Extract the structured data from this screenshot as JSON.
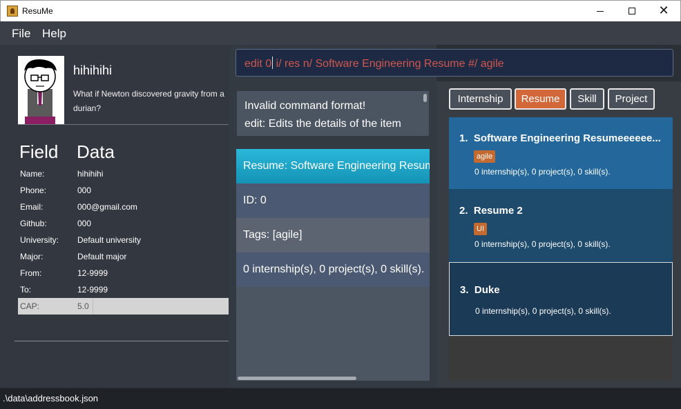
{
  "window": {
    "title": "ResuMe",
    "minimize_icon": "minimize-icon",
    "maximize_icon": "maximize-icon",
    "close_icon": "close-icon"
  },
  "menu": {
    "file": "File",
    "help": "Help"
  },
  "profile": {
    "avatar_icon": "cartoon-avatar",
    "name": "hihihihi",
    "bio": "What if Newton discovered gravity from a durian?"
  },
  "personal_table": {
    "field_header": "Field",
    "data_header": "Data",
    "rows": [
      {
        "label": "Name:",
        "value": "hihihihi"
      },
      {
        "label": "Phone:",
        "value": "000"
      },
      {
        "label": "Email:",
        "value": "000@gmail.com"
      },
      {
        "label": "Github:",
        "value": "000"
      },
      {
        "label": "University:",
        "value": "Default university"
      },
      {
        "label": "Major:",
        "value": "Default major"
      },
      {
        "label": "From:",
        "value": "12-9999"
      },
      {
        "label": "To:",
        "value": "12-9999"
      },
      {
        "label": "CAP:",
        "value": "5.0"
      }
    ]
  },
  "command": {
    "before_caret": "edit 0",
    "after_caret": " i/ res n/ Software Engineering Resume #/ agile"
  },
  "result": {
    "line1": "Invalid command format!",
    "line2": "edit: Edits the details of the item"
  },
  "detail": {
    "header": "Resume: Software Engineering Resumeeeeeeeeee",
    "id": "ID: 0",
    "tags": "Tags: [agile]",
    "summary": "0 internship(s), 0 project(s), 0 skill(s)."
  },
  "tabs": {
    "internship": "Internship",
    "resume": "Resume",
    "skill": "Skill",
    "project": "Project",
    "active": "Resume"
  },
  "resume_list": [
    {
      "index": "1.",
      "title": "Software Engineering Resumeeeeee...",
      "tag": "agile",
      "summary": "0 internship(s), 0 project(s), 0 skill(s)."
    },
    {
      "index": "2.",
      "title": "Resume 2",
      "tag": "UI",
      "summary": "0 internship(s), 0 project(s), 0 skill(s)."
    },
    {
      "index": "3.",
      "title": "Duke",
      "tag": "",
      "summary": "0 internship(s), 0 project(s), 0 skill(s)."
    }
  ],
  "status": {
    "path": ".\\data\\addressbook.json"
  },
  "colors": {
    "accent_active_tab": "#d2683a",
    "tag": "#c4692f",
    "command_text": "#d0564e",
    "selected_card": "#23679b"
  }
}
